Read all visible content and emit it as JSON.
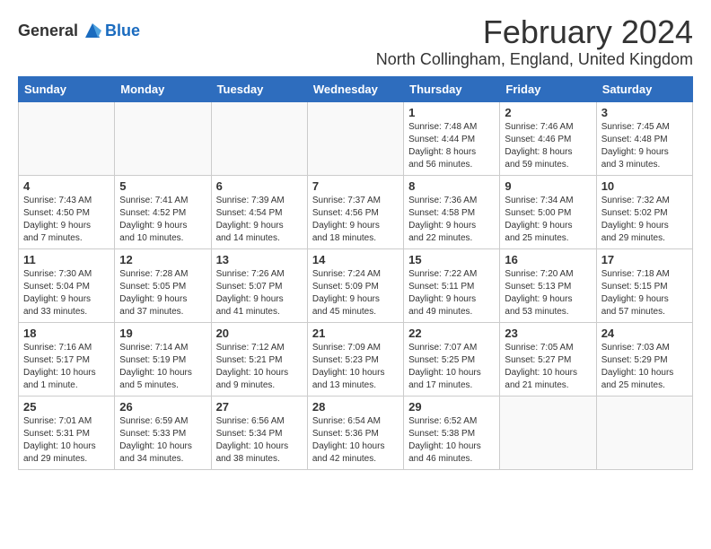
{
  "logo": {
    "general": "General",
    "blue": "Blue"
  },
  "title": "February 2024",
  "subtitle": "North Collingham, England, United Kingdom",
  "days_of_week": [
    "Sunday",
    "Monday",
    "Tuesday",
    "Wednesday",
    "Thursday",
    "Friday",
    "Saturday"
  ],
  "weeks": [
    [
      {
        "day": "",
        "info": ""
      },
      {
        "day": "",
        "info": ""
      },
      {
        "day": "",
        "info": ""
      },
      {
        "day": "",
        "info": ""
      },
      {
        "day": "1",
        "info": "Sunrise: 7:48 AM\nSunset: 4:44 PM\nDaylight: 8 hours\nand 56 minutes."
      },
      {
        "day": "2",
        "info": "Sunrise: 7:46 AM\nSunset: 4:46 PM\nDaylight: 8 hours\nand 59 minutes."
      },
      {
        "day": "3",
        "info": "Sunrise: 7:45 AM\nSunset: 4:48 PM\nDaylight: 9 hours\nand 3 minutes."
      }
    ],
    [
      {
        "day": "4",
        "info": "Sunrise: 7:43 AM\nSunset: 4:50 PM\nDaylight: 9 hours\nand 7 minutes."
      },
      {
        "day": "5",
        "info": "Sunrise: 7:41 AM\nSunset: 4:52 PM\nDaylight: 9 hours\nand 10 minutes."
      },
      {
        "day": "6",
        "info": "Sunrise: 7:39 AM\nSunset: 4:54 PM\nDaylight: 9 hours\nand 14 minutes."
      },
      {
        "day": "7",
        "info": "Sunrise: 7:37 AM\nSunset: 4:56 PM\nDaylight: 9 hours\nand 18 minutes."
      },
      {
        "day": "8",
        "info": "Sunrise: 7:36 AM\nSunset: 4:58 PM\nDaylight: 9 hours\nand 22 minutes."
      },
      {
        "day": "9",
        "info": "Sunrise: 7:34 AM\nSunset: 5:00 PM\nDaylight: 9 hours\nand 25 minutes."
      },
      {
        "day": "10",
        "info": "Sunrise: 7:32 AM\nSunset: 5:02 PM\nDaylight: 9 hours\nand 29 minutes."
      }
    ],
    [
      {
        "day": "11",
        "info": "Sunrise: 7:30 AM\nSunset: 5:04 PM\nDaylight: 9 hours\nand 33 minutes."
      },
      {
        "day": "12",
        "info": "Sunrise: 7:28 AM\nSunset: 5:05 PM\nDaylight: 9 hours\nand 37 minutes."
      },
      {
        "day": "13",
        "info": "Sunrise: 7:26 AM\nSunset: 5:07 PM\nDaylight: 9 hours\nand 41 minutes."
      },
      {
        "day": "14",
        "info": "Sunrise: 7:24 AM\nSunset: 5:09 PM\nDaylight: 9 hours\nand 45 minutes."
      },
      {
        "day": "15",
        "info": "Sunrise: 7:22 AM\nSunset: 5:11 PM\nDaylight: 9 hours\nand 49 minutes."
      },
      {
        "day": "16",
        "info": "Sunrise: 7:20 AM\nSunset: 5:13 PM\nDaylight: 9 hours\nand 53 minutes."
      },
      {
        "day": "17",
        "info": "Sunrise: 7:18 AM\nSunset: 5:15 PM\nDaylight: 9 hours\nand 57 minutes."
      }
    ],
    [
      {
        "day": "18",
        "info": "Sunrise: 7:16 AM\nSunset: 5:17 PM\nDaylight: 10 hours\nand 1 minute."
      },
      {
        "day": "19",
        "info": "Sunrise: 7:14 AM\nSunset: 5:19 PM\nDaylight: 10 hours\nand 5 minutes."
      },
      {
        "day": "20",
        "info": "Sunrise: 7:12 AM\nSunset: 5:21 PM\nDaylight: 10 hours\nand 9 minutes."
      },
      {
        "day": "21",
        "info": "Sunrise: 7:09 AM\nSunset: 5:23 PM\nDaylight: 10 hours\nand 13 minutes."
      },
      {
        "day": "22",
        "info": "Sunrise: 7:07 AM\nSunset: 5:25 PM\nDaylight: 10 hours\nand 17 minutes."
      },
      {
        "day": "23",
        "info": "Sunrise: 7:05 AM\nSunset: 5:27 PM\nDaylight: 10 hours\nand 21 minutes."
      },
      {
        "day": "24",
        "info": "Sunrise: 7:03 AM\nSunset: 5:29 PM\nDaylight: 10 hours\nand 25 minutes."
      }
    ],
    [
      {
        "day": "25",
        "info": "Sunrise: 7:01 AM\nSunset: 5:31 PM\nDaylight: 10 hours\nand 29 minutes."
      },
      {
        "day": "26",
        "info": "Sunrise: 6:59 AM\nSunset: 5:33 PM\nDaylight: 10 hours\nand 34 minutes."
      },
      {
        "day": "27",
        "info": "Sunrise: 6:56 AM\nSunset: 5:34 PM\nDaylight: 10 hours\nand 38 minutes."
      },
      {
        "day": "28",
        "info": "Sunrise: 6:54 AM\nSunset: 5:36 PM\nDaylight: 10 hours\nand 42 minutes."
      },
      {
        "day": "29",
        "info": "Sunrise: 6:52 AM\nSunset: 5:38 PM\nDaylight: 10 hours\nand 46 minutes."
      },
      {
        "day": "",
        "info": ""
      },
      {
        "day": "",
        "info": ""
      }
    ]
  ]
}
